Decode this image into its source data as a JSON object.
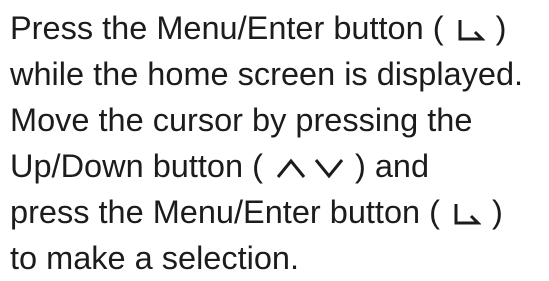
{
  "paragraph": {
    "line1": {
      "before": "Press the Menu/Enter button ( ",
      "after": " )"
    },
    "line2": "while the home screen is displayed.",
    "line3": "Move the cursor by pressing the",
    "line4": {
      "before": "Up/Down button ( ",
      "after": " ) and"
    },
    "line5": {
      "before": "press the Menu/Enter button ( ",
      "after": " )"
    },
    "line6": "to make a selection."
  },
  "icons": {
    "enter": "enter-icon",
    "up": "up-chevron-icon",
    "down": "down-chevron-icon"
  }
}
